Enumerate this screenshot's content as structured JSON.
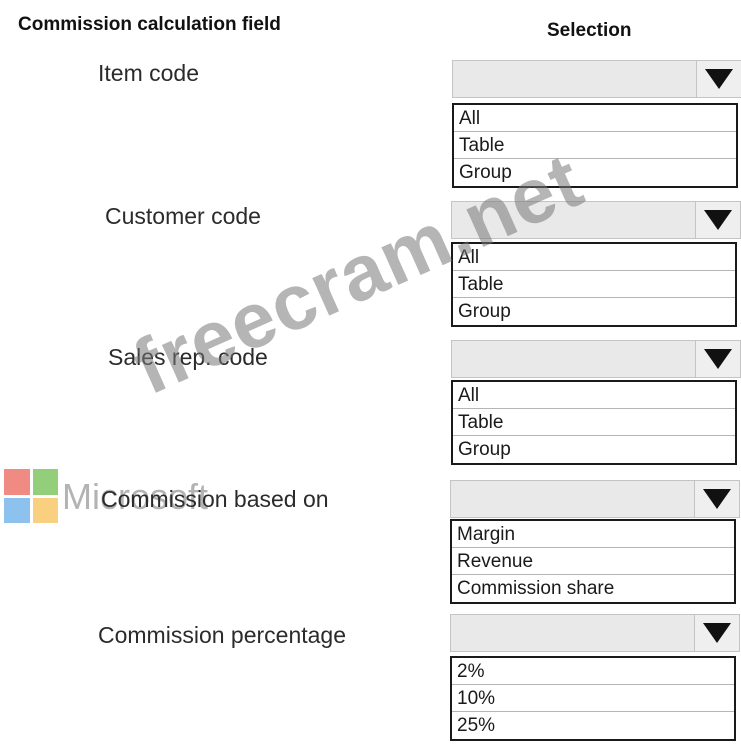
{
  "headers": {
    "field": "Commission calculation field",
    "selection": "Selection"
  },
  "rows": [
    {
      "label": "Item code",
      "options": [
        "All",
        "Table",
        "Group"
      ]
    },
    {
      "label": "Customer code",
      "options": [
        "All",
        "Table",
        "Group"
      ]
    },
    {
      "label": "Sales rep. code",
      "options": [
        "All",
        "Table",
        "Group"
      ]
    },
    {
      "label": "Commission based on",
      "options": [
        "Margin",
        "Revenue",
        "Commission share"
      ]
    },
    {
      "label": "Commission percentage",
      "options": [
        "2%",
        "10%",
        "25%"
      ]
    }
  ],
  "overlay": {
    "ms_text": "Microsoft",
    "watermark": "freecram.net"
  },
  "icons": {
    "dropdown": "chevron-down-icon",
    "logo": "microsoft-logo-icon"
  }
}
